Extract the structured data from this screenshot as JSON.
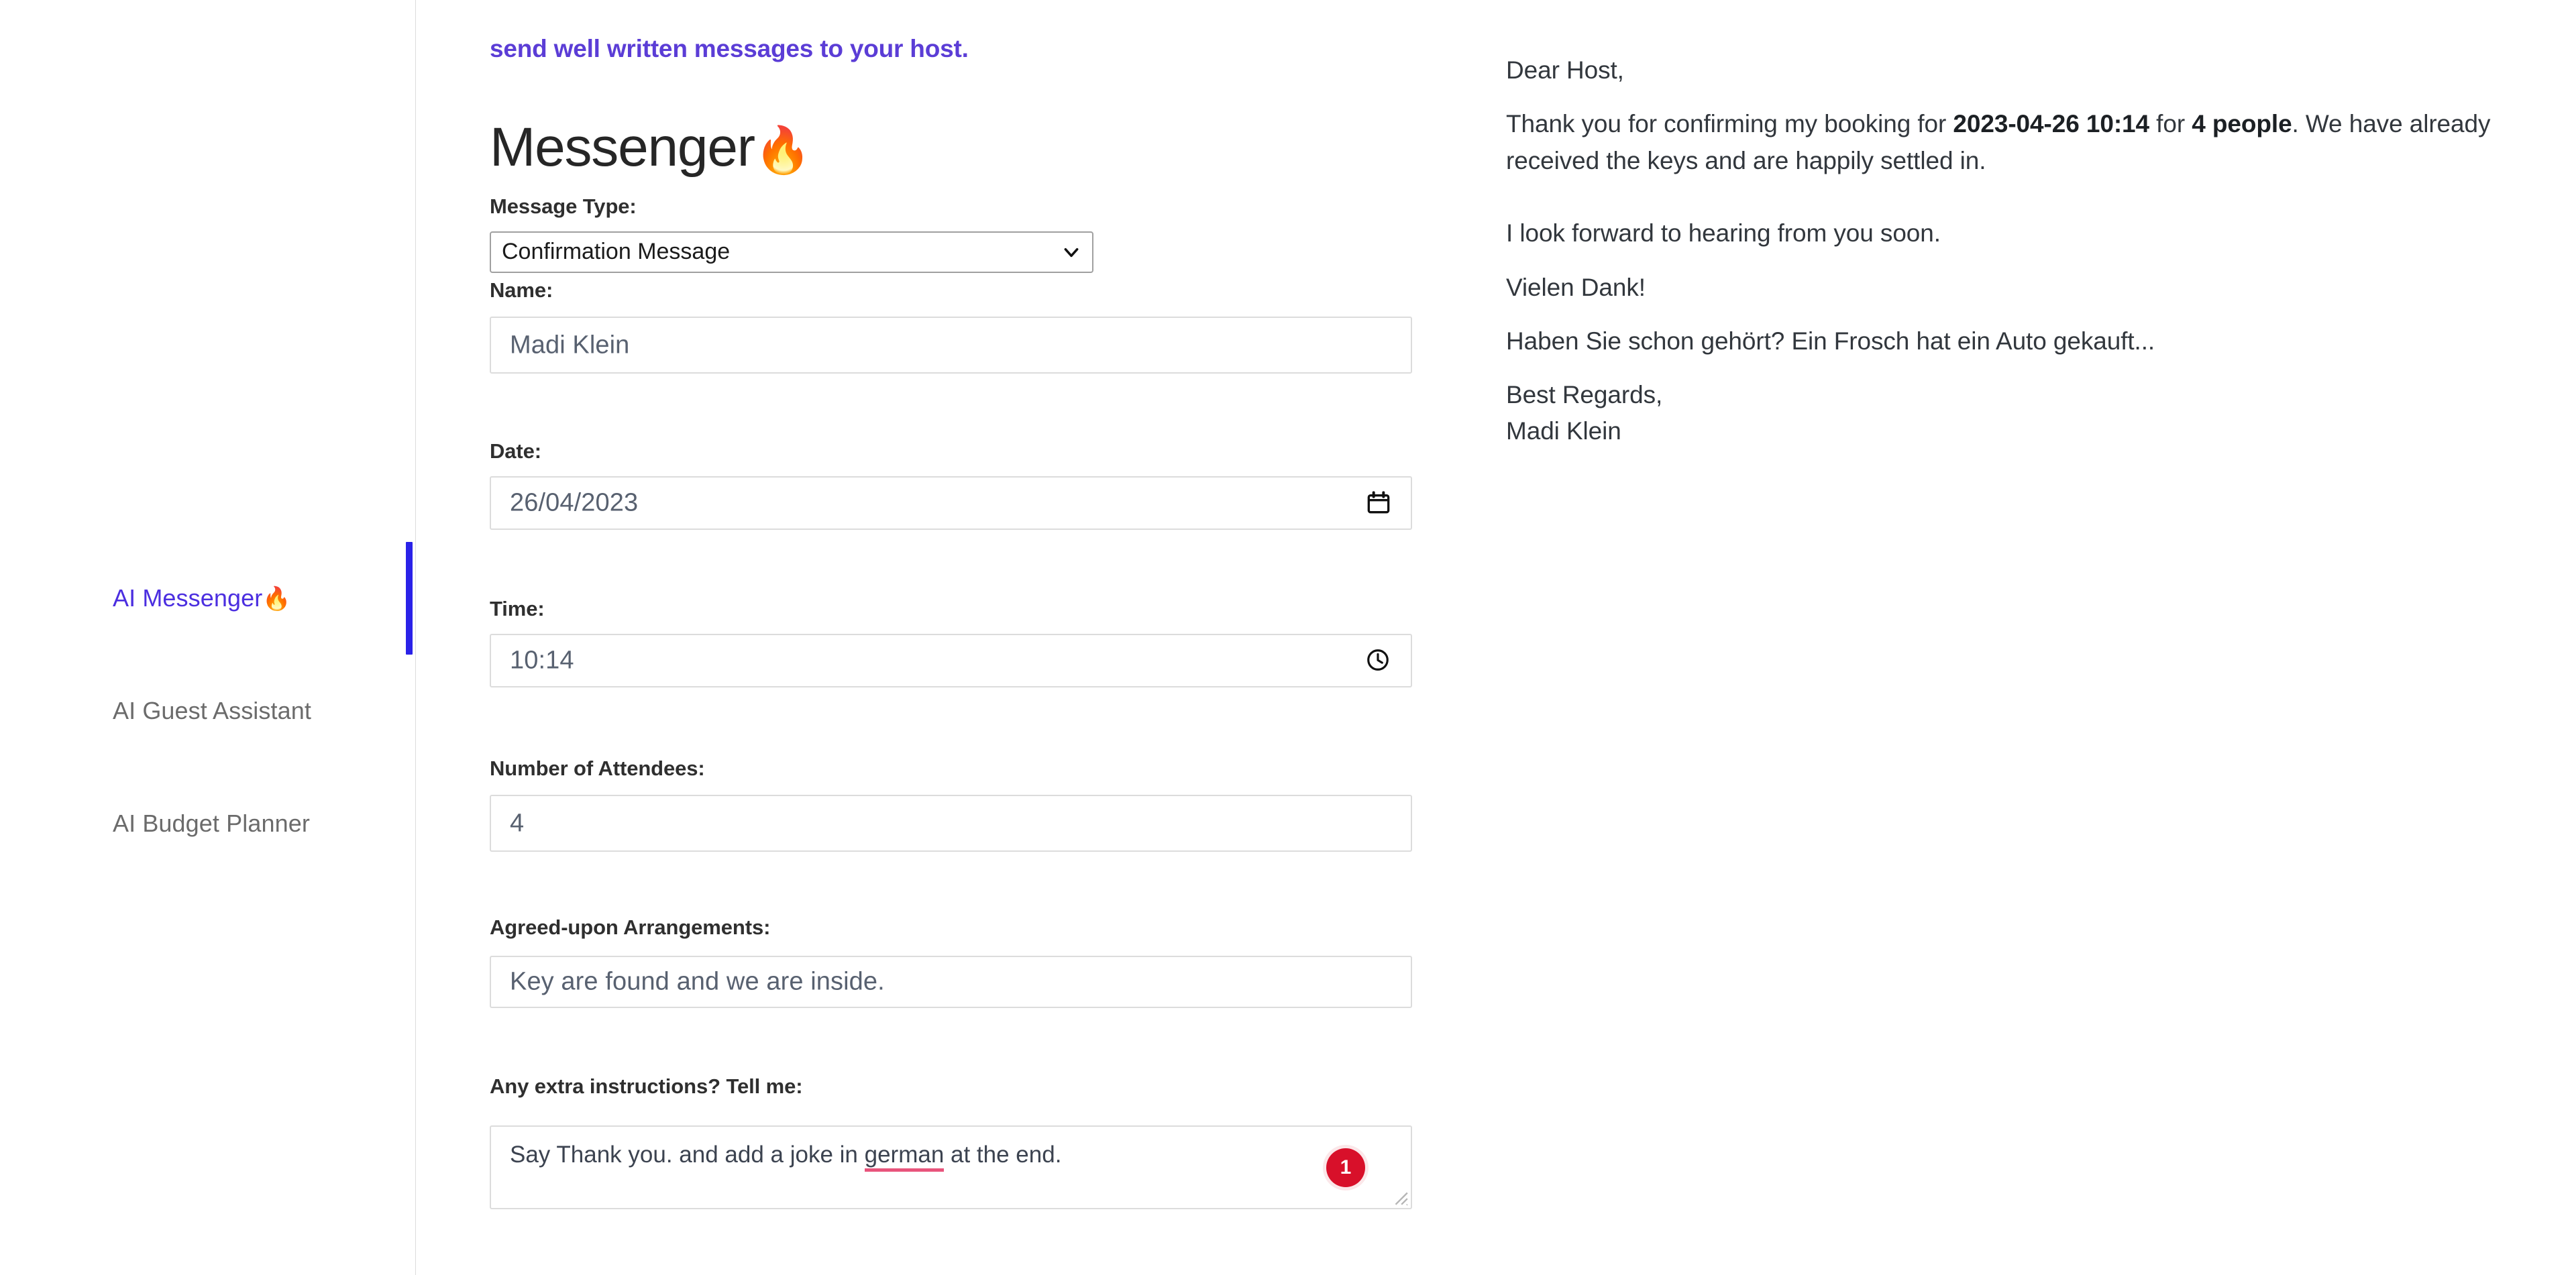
{
  "sidebar": {
    "items": [
      {
        "label": "AI Messenger",
        "emoji": "🔥",
        "active": true
      },
      {
        "label": "AI Guest Assistant",
        "emoji": "",
        "active": false
      },
      {
        "label": "AI Budget Planner",
        "emoji": "",
        "active": false
      }
    ]
  },
  "main": {
    "tagline": "send well written messages to your host.",
    "title": "Messenger",
    "title_emoji": "🔥",
    "fields": {
      "message_type": {
        "label": "Message Type:",
        "value": "Confirmation Message",
        "options": [
          "Confirmation Message"
        ]
      },
      "name": {
        "label": "Name:",
        "value": "Madi Klein"
      },
      "date": {
        "label": "Date:",
        "value": "26/04/2023"
      },
      "time": {
        "label": "Time:",
        "value": "10:14"
      },
      "attendees": {
        "label": "Number of Attendees:",
        "value": "4"
      },
      "arrangements": {
        "label": "Agreed-upon Arrangements:",
        "value": "Key are found and we are inside."
      },
      "extra_instructions": {
        "label": "Any extra instructions? Tell me:",
        "value_before": "Say Thank you. and add a joke in ",
        "value_misspelled": "german",
        "value_after": " at the end.",
        "grammar_issue_count": "1"
      }
    }
  },
  "output": {
    "greeting": "Dear Host,",
    "body_p1_before": "Thank you for confirming my booking for ",
    "body_p1_datetime": "2023-04-26 10:14",
    "body_p1_mid": " for ",
    "body_p1_people": "4 people",
    "body_p1_after": ". We have already received the keys and are happily settled in.",
    "body_p2": "I look forward to hearing from you soon.",
    "body_p3": "Vielen Dank!",
    "body_p4": "Haben Sie schon gehört? Ein Frosch hat ein Auto gekauft...",
    "closing": "Best Regards,",
    "signature": "Madi Klein"
  },
  "colors": {
    "accent_purple": "#5b3dd6",
    "active_bar_blue": "#2a22e8",
    "badge_red": "#d8102a",
    "spell_underline": "#e8547c"
  }
}
